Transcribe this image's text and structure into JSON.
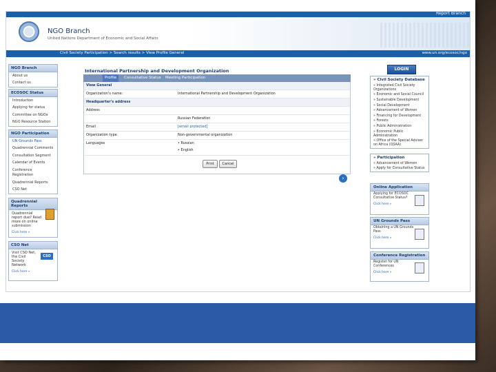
{
  "header": {
    "report_link": "Report Branch",
    "brand": "NGO Branch",
    "brand_sub": "United Nations Department of Economic and Social Affairs",
    "breadcrumbs": "Civil Society Participation > Search results > View Profile General",
    "url": "www.un.org/ecosoc/ngo"
  },
  "left": {
    "ngo_branch": {
      "title": "NGO Branch",
      "items": [
        "About us",
        "Contact us"
      ]
    },
    "ecosoc": {
      "title": "ECOSOC Status",
      "items": [
        "Introduction",
        "Applying for status",
        "Committee on NGOs",
        "NGO Resource Station"
      ]
    },
    "participation": {
      "title": "NGO Participation",
      "items": [
        "UN Grounds Pass",
        "Quadrennial Comments",
        "Consultation Segment",
        "Calendar of Events",
        "Conference Registration",
        "Quadrennial Reports",
        "CSO Net"
      ]
    },
    "quadrennial": {
      "title": "Quadrennial Reports",
      "text": "Quadrennial report due? Read more on online submission",
      "more": "Click here »"
    },
    "csonet": {
      "title": "CSO Net",
      "text": "Visit CSO Net, the Civil Society Network",
      "badge": "CSO",
      "more": "Click here »"
    }
  },
  "main": {
    "title": "International Partnership and Development Organization",
    "tabs": [
      "Profile",
      "Consultative Status",
      "Meeting Participation"
    ],
    "sections": {
      "general": "View General",
      "hq": "Headquarter's address"
    },
    "rows": {
      "org_name_label": "Organization's name:",
      "org_name_value": "International Partnership and Development Organization",
      "address_label": "Address",
      "country_value": "Russian Federation",
      "email_label": "Email",
      "email_value": "[email protected]",
      "org_type_label": "Organization type",
      "org_type_value": "Non-governmental organization",
      "languages_label": "Languages",
      "lang_1": "• Russian",
      "lang_2": "• English"
    },
    "buttons": {
      "print": "Print",
      "cancel": "Cancel"
    }
  },
  "right": {
    "login": "LOGIN",
    "civil_society": {
      "title": "» Civil Society Database",
      "items": [
        "» Integrated Civil Society Organizations",
        "» Economic and Social Council",
        "» Sustainable Development",
        "» Social Development",
        "» Advancement of Women",
        "» Financing for Development",
        "» Forests",
        "» Public Administration",
        "» Economic Public Administration",
        "» Office of the Special Adviser on Africa (OSAA)"
      ]
    },
    "participation": {
      "title": "» Participation",
      "items": [
        "» Advancement of Women",
        "» Apply for Consultative Status"
      ]
    },
    "online_app": {
      "title": "Online Application",
      "text": "Applying for ECOSOC Consultative Status?",
      "more": "Click here »"
    },
    "grounds_pass": {
      "title": "UN Grounds Pass",
      "text": "Obtaining a UN Grounds Pass",
      "more": "Click here »"
    },
    "conf_reg": {
      "title": "Conference Registration",
      "text": "Register for UN Conferences",
      "more": "Click here »"
    }
  }
}
